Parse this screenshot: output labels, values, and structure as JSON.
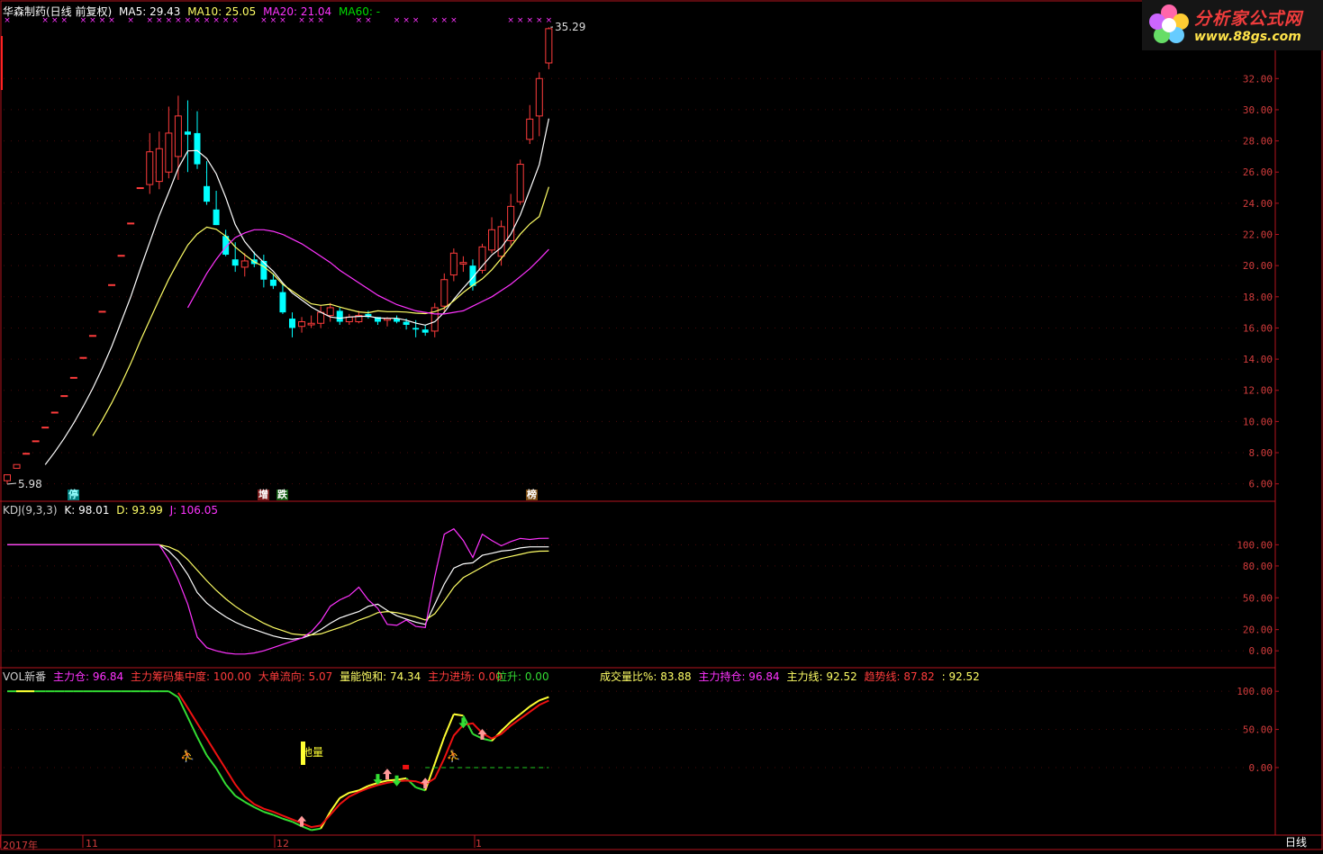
{
  "main_header": {
    "stock": "华森制药(日线 前复权)",
    "ma5": "MA5: 29.43",
    "ma10": "MA10: 25.05",
    "ma20": "MA20: 21.04",
    "ma60": "MA60: -"
  },
  "kdj_header": {
    "name": "KDJ(9,3,3)",
    "k": "K: 98.01",
    "d": "D: 93.99",
    "j": "J: 106.05"
  },
  "vol_header": {
    "name": "VOL新番",
    "main_pos": "主力仓: 96.84",
    "chip": "主力筹码集中度: 100.00",
    "big_flow": "大单流向: 5.07",
    "vol_sat": "量能饱和: 74.34",
    "entry": "主力进场: 0.00",
    "lift": "拉升: 0.00",
    "turnover": "成交量比%: 83.88",
    "hold": "主力持仓: 96.84",
    "main_line": "主力线: 92.52",
    "trend": "趋势线: 87.82",
    "last": ": 92.52"
  },
  "logo": {
    "title": "分析家公式网",
    "url": "www.88gs.com"
  },
  "price_labels": {
    "high": "35.29",
    "low": "5.98"
  },
  "signals": {
    "stop": "停",
    "add": "增",
    "drop": "跌",
    "list": "榜",
    "vol_tag": "地量"
  },
  "axis_bottom": {
    "year": "2017年",
    "nov": "11",
    "dec": "12",
    "jan": "1",
    "period": "日线"
  },
  "colors": {
    "up": "#ff3c3c",
    "down": "#00ffff",
    "ma5": "#ffffff",
    "ma10": "#ffff66",
    "ma20": "#ff33ff",
    "ma60": "#00dd00",
    "axis": "#b4141e"
  },
  "chart_data": [
    {
      "type": "candlestick",
      "title": "华森制药(日线 前复权)",
      "y_ticks": [
        6,
        8,
        10,
        12,
        14,
        16,
        18,
        20,
        22,
        24,
        26,
        28,
        30,
        32
      ],
      "ylim": [
        5,
        36
      ],
      "candles": [
        [
          6.2,
          6.6,
          5.98,
          6.58
        ],
        [
          7.0,
          7.24,
          7.0,
          7.24
        ],
        [
          7.96,
          7.96,
          7.96,
          7.96
        ],
        [
          8.76,
          8.76,
          8.76,
          8.76
        ],
        [
          9.64,
          9.64,
          9.64,
          9.64
        ],
        [
          10.6,
          10.6,
          10.6,
          10.6
        ],
        [
          11.66,
          11.66,
          11.66,
          11.66
        ],
        [
          12.83,
          12.83,
          12.83,
          12.83
        ],
        [
          14.11,
          14.11,
          14.11,
          14.11
        ],
        [
          15.52,
          15.52,
          15.52,
          15.52
        ],
        [
          17.07,
          17.07,
          17.07,
          17.07
        ],
        [
          18.78,
          18.78,
          18.78,
          18.78
        ],
        [
          20.66,
          20.66,
          20.66,
          20.66
        ],
        [
          22.73,
          22.73,
          22.73,
          22.73
        ],
        [
          25.0,
          25.0,
          25.0,
          25.0
        ],
        [
          25.2,
          28.5,
          24.6,
          27.3
        ],
        [
          25.4,
          28.6,
          24.9,
          27.5
        ],
        [
          26.0,
          30.2,
          25.6,
          28.5
        ],
        [
          27.0,
          30.9,
          25.5,
          29.6
        ],
        [
          28.6,
          30.6,
          26.0,
          28.4
        ],
        [
          28.5,
          29.9,
          26.2,
          26.5
        ],
        [
          25.1,
          26.7,
          23.9,
          24.1
        ],
        [
          23.6,
          24.8,
          22.6,
          22.6
        ],
        [
          21.9,
          22.3,
          20.6,
          20.7
        ],
        [
          20.4,
          21.5,
          19.6,
          20.0
        ],
        [
          19.9,
          20.8,
          19.3,
          20.3
        ],
        [
          20.4,
          20.9,
          19.9,
          20.1
        ],
        [
          20.3,
          20.7,
          18.6,
          19.1
        ],
        [
          19.1,
          19.5,
          18.5,
          18.7
        ],
        [
          18.3,
          18.8,
          16.9,
          17.0
        ],
        [
          16.6,
          17.0,
          15.4,
          16.0
        ],
        [
          16.1,
          16.7,
          15.7,
          16.4
        ],
        [
          16.2,
          16.8,
          16.0,
          16.3
        ],
        [
          16.3,
          17.4,
          16.0,
          17.0
        ],
        [
          16.8,
          17.6,
          16.4,
          17.3
        ],
        [
          17.1,
          17.3,
          16.2,
          16.4
        ],
        [
          16.4,
          16.9,
          16.2,
          16.7
        ],
        [
          16.4,
          17.1,
          16.3,
          16.8
        ],
        [
          16.9,
          17.1,
          16.6,
          16.7
        ],
        [
          16.7,
          16.7,
          16.2,
          16.4
        ],
        [
          16.5,
          16.7,
          16.1,
          16.6
        ],
        [
          16.6,
          16.8,
          16.3,
          16.4
        ],
        [
          16.4,
          16.6,
          15.9,
          16.2
        ],
        [
          16.0,
          16.5,
          15.4,
          15.9
        ],
        [
          15.9,
          16.2,
          15.5,
          15.7
        ],
        [
          15.8,
          17.6,
          15.4,
          17.3
        ],
        [
          17.4,
          19.5,
          17.0,
          19.1
        ],
        [
          19.4,
          21.1,
          19.0,
          20.8
        ],
        [
          20.1,
          20.6,
          19.6,
          20.2
        ],
        [
          20.0,
          20.4,
          18.4,
          18.7
        ],
        [
          19.7,
          21.4,
          19.5,
          21.2
        ],
        [
          21.0,
          23.1,
          20.8,
          22.3
        ],
        [
          20.6,
          22.9,
          20.0,
          22.5
        ],
        [
          21.6,
          24.6,
          21.3,
          23.8
        ],
        [
          24.1,
          26.8,
          23.9,
          26.5
        ],
        [
          28.1,
          30.3,
          27.8,
          29.4
        ],
        [
          29.6,
          32.4,
          28.3,
          32.0
        ],
        [
          33.0,
          35.29,
          32.6,
          35.2
        ]
      ],
      "ma5": [
        null,
        null,
        null,
        null,
        7.23,
        8.04,
        8.92,
        9.9,
        10.97,
        12.13,
        13.41,
        14.82,
        16.4,
        18.0,
        19.78,
        21.5,
        23.21,
        24.71,
        26.25,
        27.36,
        27.38,
        26.87,
        25.89,
        24.37,
        22.63,
        21.54,
        20.8,
        20.2,
        19.64,
        18.89,
        18.24,
        17.79,
        17.35,
        17.01,
        16.71,
        16.62,
        16.7,
        16.74,
        16.76,
        16.64,
        16.62,
        16.62,
        16.5,
        16.31,
        16.18,
        16.4,
        17.0,
        17.84,
        18.56,
        19.24,
        19.98,
        20.68,
        21.16,
        22.02,
        23.25,
        24.86,
        26.48,
        29.43
      ],
      "ma10": [
        null,
        null,
        null,
        null,
        null,
        null,
        null,
        null,
        null,
        9.08,
        10.09,
        11.2,
        12.41,
        13.73,
        15.16,
        16.51,
        17.84,
        19.13,
        20.26,
        21.32,
        22.03,
        22.47,
        22.33,
        21.89,
        21.2,
        20.69,
        20.24,
        19.94,
        19.45,
        18.79,
        18.37,
        17.94,
        17.55,
        17.45,
        17.52,
        17.34,
        17.18,
        17.03,
        16.98,
        17.1,
        17.05,
        17.05,
        17.02,
        16.95,
        16.92,
        17.05,
        17.28,
        17.74,
        18.28,
        18.74,
        19.15,
        19.73,
        20.46,
        21.22,
        22.02,
        22.67,
        23.15,
        25.05
      ],
      "ma20": [
        null,
        null,
        null,
        null,
        null,
        null,
        null,
        null,
        null,
        null,
        null,
        null,
        null,
        null,
        null,
        null,
        null,
        null,
        null,
        17.3,
        18.4,
        19.5,
        20.4,
        21.2,
        21.8,
        22.1,
        22.3,
        22.3,
        22.2,
        22.0,
        21.7,
        21.4,
        21.0,
        20.6,
        20.2,
        19.7,
        19.3,
        18.9,
        18.5,
        18.1,
        17.8,
        17.5,
        17.3,
        17.1,
        17.0,
        16.9,
        16.9,
        17.0,
        17.1,
        17.4,
        17.7,
        18.0,
        18.4,
        18.8,
        19.3,
        19.8,
        20.4,
        21.04
      ]
    },
    {
      "type": "line",
      "title": "KDJ(9,3,3)",
      "y_ticks": [
        0,
        20,
        50,
        80,
        100
      ],
      "ylim": [
        -10,
        130
      ],
      "series": [
        {
          "name": "K",
          "values": [
            100,
            100,
            100,
            100,
            100,
            100,
            100,
            100,
            100,
            100,
            100,
            100,
            100,
            100,
            100,
            100,
            100,
            94,
            85,
            72,
            55,
            45,
            38,
            32,
            27,
            23,
            20,
            17,
            14,
            12,
            11,
            12,
            15,
            20,
            26,
            31,
            34,
            37,
            42,
            44,
            38,
            33,
            30,
            27,
            25,
            44,
            63,
            78,
            82,
            83,
            90,
            92,
            94,
            95,
            97,
            98,
            98,
            98.01
          ]
        },
        {
          "name": "D",
          "values": [
            100,
            100,
            100,
            100,
            100,
            100,
            100,
            100,
            100,
            100,
            100,
            100,
            100,
            100,
            100,
            100,
            100,
            98,
            94,
            86,
            76,
            66,
            57,
            49,
            42,
            36,
            31,
            26,
            22,
            19,
            16,
            15,
            15,
            16,
            19,
            22,
            25,
            29,
            32,
            36,
            37,
            36,
            34,
            32,
            29,
            35,
            47,
            60,
            69,
            74,
            79,
            84,
            87,
            89,
            91,
            93,
            93.9,
            93.99
          ]
        },
        {
          "name": "J",
          "values": [
            100,
            100,
            100,
            100,
            100,
            100,
            100,
            100,
            100,
            100,
            100,
            100,
            100,
            100,
            100,
            100,
            100,
            86,
            67,
            44,
            13,
            3,
            0,
            -2,
            -3,
            -3,
            -2,
            0,
            3,
            6,
            9,
            12,
            18,
            28,
            42,
            48,
            52,
            60,
            48,
            40,
            25,
            24,
            29,
            23,
            22,
            70,
            110,
            115,
            104,
            88,
            110,
            104,
            99,
            103,
            106,
            105,
            106,
            106.05
          ]
        }
      ]
    },
    {
      "type": "line",
      "title": "VOL新番",
      "y_ticks": [
        0,
        50,
        100
      ],
      "ylim": [
        -85,
        112
      ],
      "series": [
        {
          "name": "主力线",
          "values": [
            100,
            100,
            100,
            100,
            100,
            100,
            100,
            100,
            100,
            100,
            100,
            100,
            100,
            100,
            100,
            100,
            100,
            100,
            92,
            66,
            40,
            16,
            -1,
            -22,
            -37,
            -45,
            -52,
            -58,
            -62,
            -67,
            -71,
            -77,
            -82,
            -80,
            -58,
            -40,
            -33,
            -30,
            -24,
            -20,
            -17,
            -16,
            -14,
            -26,
            -30,
            5,
            40,
            70,
            68,
            44,
            38,
            35,
            48,
            60,
            70,
            80,
            88,
            92.52
          ]
        },
        {
          "name": "趋势线",
          "values": [
            null,
            null,
            null,
            null,
            null,
            null,
            null,
            null,
            null,
            null,
            null,
            null,
            null,
            null,
            null,
            null,
            null,
            null,
            98,
            78,
            58,
            38,
            18,
            -2,
            -22,
            -38,
            -48,
            -54,
            -58,
            -63,
            -68,
            -73,
            -78,
            -76,
            -62,
            -48,
            -38,
            -32,
            -27,
            -23,
            -20,
            -18,
            -17,
            -18,
            -22,
            -14,
            12,
            42,
            56,
            58,
            45,
            38,
            44,
            55,
            64,
            73,
            82,
            87.82
          ]
        }
      ]
    }
  ]
}
